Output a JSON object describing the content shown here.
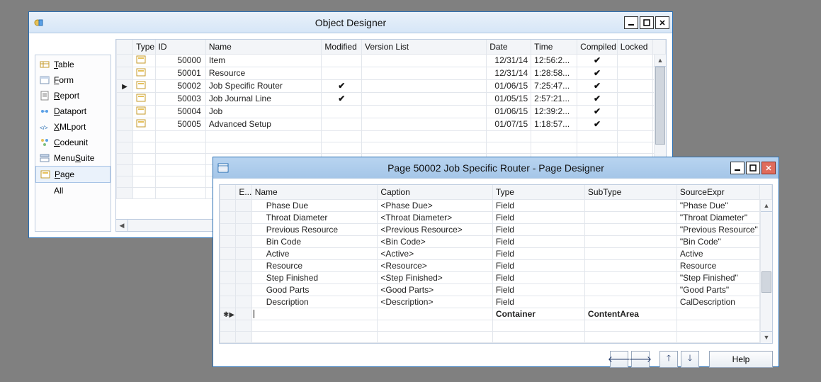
{
  "obj_designer": {
    "title": "Object Designer",
    "nav": [
      {
        "label": "Table",
        "key": "table"
      },
      {
        "label": "Form",
        "key": "form"
      },
      {
        "label": "Report",
        "key": "report"
      },
      {
        "label": "Dataport",
        "key": "dataport"
      },
      {
        "label": "XMLport",
        "key": "xmlport"
      },
      {
        "label": "Codeunit",
        "key": "codeunit"
      },
      {
        "label": "MenuSuite",
        "key": "menusuite"
      },
      {
        "label": "Page",
        "key": "page",
        "selected": true
      },
      {
        "label": "All",
        "key": "all"
      }
    ],
    "columns": [
      "Type",
      "ID",
      "Name",
      "Modified",
      "Version List",
      "Date",
      "Time",
      "Compiled",
      "Locked"
    ],
    "rows": [
      {
        "sel": false,
        "id": "50000",
        "name": "Item",
        "modified": false,
        "version": "",
        "date": "12/31/14",
        "time": "12:56:2...",
        "compiled": true,
        "locked": ""
      },
      {
        "sel": false,
        "id": "50001",
        "name": "Resource",
        "modified": false,
        "version": "",
        "date": "12/31/14",
        "time": "1:28:58...",
        "compiled": true,
        "locked": ""
      },
      {
        "sel": true,
        "id": "50002",
        "name": "Job Specific Router",
        "modified": true,
        "version": "",
        "date": "01/06/15",
        "time": "7:25:47...",
        "compiled": true,
        "locked": ""
      },
      {
        "sel": false,
        "id": "50003",
        "name": "Job Journal Line",
        "modified": true,
        "version": "",
        "date": "01/05/15",
        "time": "2:57:21...",
        "compiled": true,
        "locked": ""
      },
      {
        "sel": false,
        "id": "50004",
        "name": "Job",
        "modified": false,
        "version": "",
        "date": "01/06/15",
        "time": "12:39:2...",
        "compiled": true,
        "locked": ""
      },
      {
        "sel": false,
        "id": "50005",
        "name": "Advanced Setup",
        "modified": false,
        "version": "",
        "date": "01/07/15",
        "time": "1:18:57...",
        "compiled": true,
        "locked": ""
      }
    ]
  },
  "page_designer": {
    "title": "Page 50002 Job Specific Router - Page Designer",
    "columns": [
      "Name",
      "Caption",
      "Type",
      "SubType",
      "SourceExpr"
    ],
    "rows": [
      {
        "name": "Phase Due",
        "caption": "<Phase Due>",
        "type": "Field",
        "subtype": "",
        "source": "\"Phase Due\""
      },
      {
        "name": "Throat Diameter",
        "caption": "<Throat Diameter>",
        "type": "Field",
        "subtype": "",
        "source": "\"Throat Diameter\""
      },
      {
        "name": "Previous Resource",
        "caption": "<Previous Resource>",
        "type": "Field",
        "subtype": "",
        "source": "\"Previous Resource\""
      },
      {
        "name": "Bin Code",
        "caption": "<Bin Code>",
        "type": "Field",
        "subtype": "",
        "source": "\"Bin Code\""
      },
      {
        "name": "Active",
        "caption": "<Active>",
        "type": "Field",
        "subtype": "",
        "source": "Active"
      },
      {
        "name": "Resource",
        "caption": "<Resource>",
        "type": "Field",
        "subtype": "",
        "source": "Resource"
      },
      {
        "name": "Step Finished",
        "caption": "<Step Finished>",
        "type": "Field",
        "subtype": "",
        "source": "\"Step Finished\""
      },
      {
        "name": "Good Parts",
        "caption": "<Good Parts>",
        "type": "Field",
        "subtype": "",
        "source": "\"Good Parts\""
      },
      {
        "name": "Description",
        "caption": "<Description>",
        "type": "Field",
        "subtype": "",
        "source": "CalDescription"
      }
    ],
    "newrow": {
      "name": "",
      "caption": "",
      "type": "Container",
      "subtype": "ContentArea",
      "source": ""
    },
    "help_label": "Help"
  }
}
